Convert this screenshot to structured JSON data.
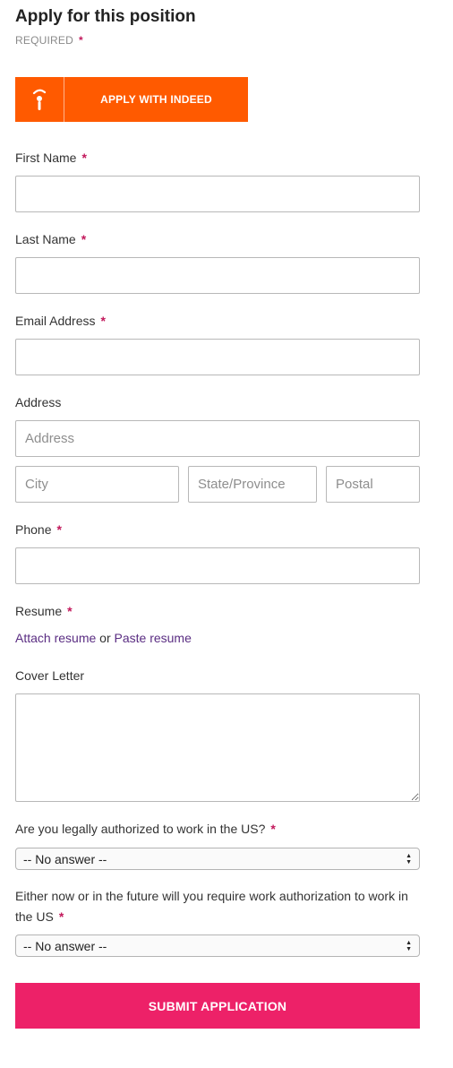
{
  "form": {
    "title": "Apply for this position",
    "required_label": "REQUIRED",
    "required_star": "*",
    "indeed_button": "APPLY WITH INDEED",
    "fields": {
      "first_name": {
        "label": "First Name",
        "value": ""
      },
      "last_name": {
        "label": "Last Name",
        "value": ""
      },
      "email": {
        "label": "Email Address",
        "value": ""
      },
      "address": {
        "label": "Address",
        "placeholder": "Address",
        "city_placeholder": "City",
        "state_placeholder": "State/Province",
        "postal_placeholder": "Postal"
      },
      "phone": {
        "label": "Phone",
        "value": ""
      },
      "resume": {
        "label": "Resume",
        "attach_link": "Attach resume",
        "or_text": "or",
        "paste_link": "Paste resume"
      },
      "cover_letter": {
        "label": "Cover Letter",
        "value": ""
      }
    },
    "questions": [
      {
        "text": "Are you legally authorized to work in the US?",
        "selected": "-- No answer --"
      },
      {
        "text": "Either now or in the future will you require work authorization to work in the US",
        "selected": "-- No answer --"
      }
    ],
    "submit_button": "SUBMIT APPLICATION"
  },
  "colors": {
    "indeed_orange": "#ff5a00",
    "submit_pink": "#ed2168",
    "required_star": "#c2185b",
    "link_purple": "#5a2d82"
  }
}
